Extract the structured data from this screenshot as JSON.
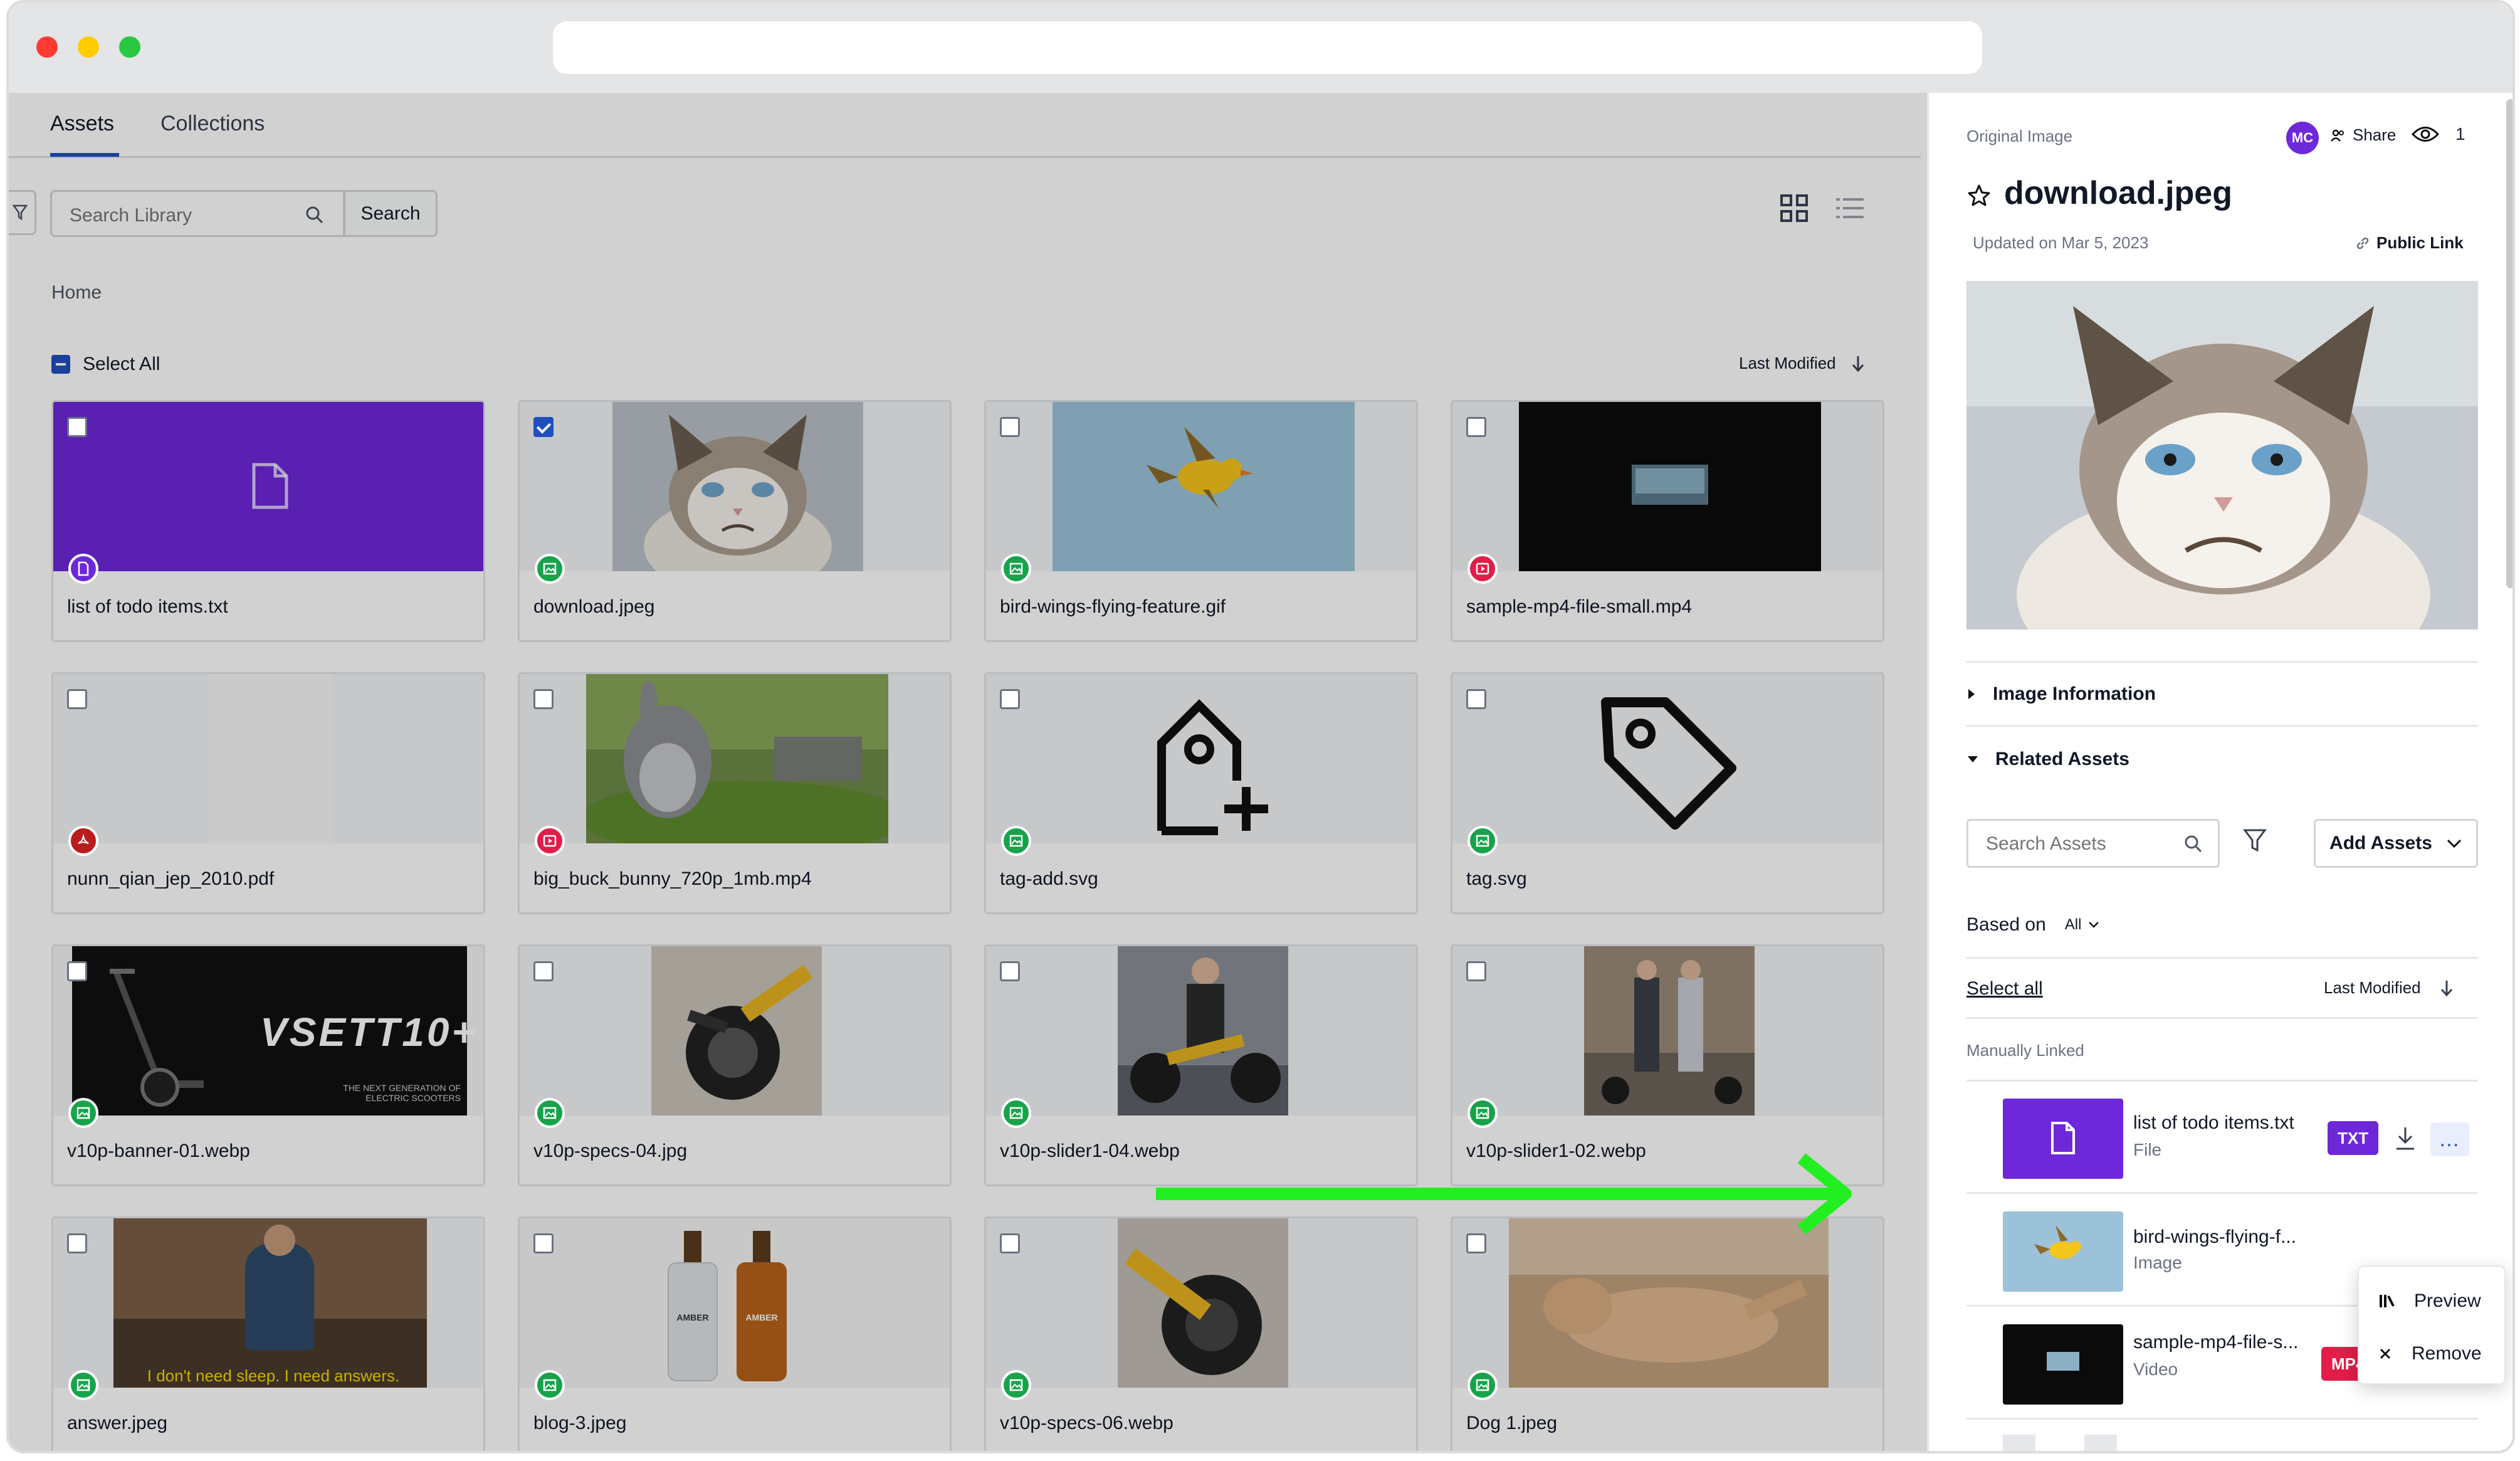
{
  "tabs": [
    {
      "label": "Assets",
      "active": true
    },
    {
      "label": "Collections",
      "active": false
    }
  ],
  "search": {
    "placeholder": "Search Library",
    "button_label": "Search"
  },
  "breadcrumb": "Home",
  "select_all_label": "Select All",
  "sort_label": "Last Modified",
  "assets": [
    {
      "name": "list of todo items.txt",
      "checked": false,
      "type": "txt"
    },
    {
      "name": "download.jpeg",
      "checked": true,
      "type": "image"
    },
    {
      "name": "bird-wings-flying-feature.gif",
      "checked": false,
      "type": "image"
    },
    {
      "name": "sample-mp4-file-small.mp4",
      "checked": false,
      "type": "video"
    },
    {
      "name": "nunn_qian_jep_2010.pdf",
      "checked": false,
      "type": "pdf"
    },
    {
      "name": "big_buck_bunny_720p_1mb.mp4",
      "checked": false,
      "type": "video"
    },
    {
      "name": "tag-add.svg",
      "checked": false,
      "type": "image"
    },
    {
      "name": "tag.svg",
      "checked": false,
      "type": "image"
    },
    {
      "name": "v10p-banner-01.webp",
      "checked": false,
      "type": "image"
    },
    {
      "name": "v10p-specs-04.jpg",
      "checked": false,
      "type": "image"
    },
    {
      "name": "v10p-slider1-04.webp",
      "checked": false,
      "type": "image"
    },
    {
      "name": "v10p-slider1-02.webp",
      "checked": false,
      "type": "image"
    },
    {
      "name": "answer.jpeg",
      "checked": false,
      "type": "image"
    },
    {
      "name": "blog-3.jpeg",
      "checked": false,
      "type": "image"
    },
    {
      "name": "v10p-specs-06.webp",
      "checked": false,
      "type": "image"
    },
    {
      "name": "Dog 1.jpeg",
      "checked": false,
      "type": "image"
    }
  ],
  "thumb_text": {
    "banner": "VSETT10+",
    "banner_sub": "THE NEXT GENERATION OF ELECTRIC SCOOTERS",
    "bottle": "AMBER",
    "answer_caption": "I don't need sleep. I need answers."
  },
  "detail": {
    "kicker": "Original Image",
    "title": "download.jpeg",
    "updated": "Updated on Mar 5, 2023",
    "avatar_initials": "MC",
    "share_label": "Share",
    "viewers_count": "1",
    "public_link_label": "Public Link",
    "image_info_label": "Image Information",
    "related_label": "Related Assets",
    "related_search_placeholder": "Search Assets",
    "add_assets_label": "Add Assets",
    "based_on_label": "Based on",
    "based_on_value": "All",
    "select_all_label": "Select all",
    "sort_label": "Last Modified",
    "manually_linked_label": "Manually Linked",
    "related": [
      {
        "name": "list of todo items.txt",
        "type": "File",
        "badge": "TXT",
        "badge_color": "#6d28d9"
      },
      {
        "name": "bird-wings-flying-f...",
        "type": "Image",
        "badge": "",
        "badge_color": ""
      },
      {
        "name": "sample-mp4-file-s...",
        "type": "Video",
        "badge": "MP4",
        "badge_color": "#e11d48"
      }
    ],
    "menu": [
      {
        "label": "Preview"
      },
      {
        "label": "Remove"
      }
    ]
  },
  "colors": {
    "accent": "#1f4fbf",
    "purple": "#6d28d9",
    "image_badge": "#16a34a",
    "video_badge": "#e11d48",
    "arrow": "#22ee22"
  }
}
